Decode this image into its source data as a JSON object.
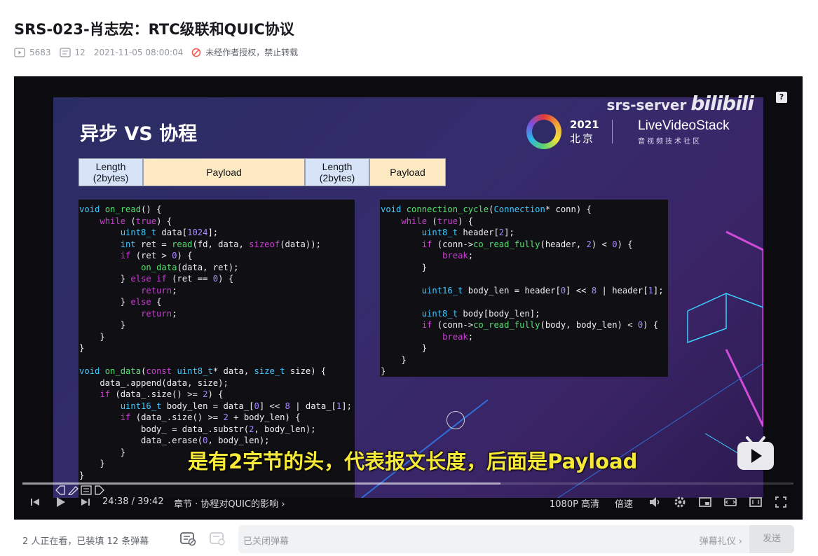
{
  "video": {
    "title": "SRS-023-肖志宏：RTC级联和QUIC协议",
    "views": "5683",
    "danmaku_count": "12",
    "publish_time": "2021-11-05 08:00:04",
    "copyright": "未经作者授权，禁止转载"
  },
  "player": {
    "watermark": "srs-server",
    "watermark_logo": "bilibili",
    "help": "?",
    "subtitle": "是有2字节的头，代表报文长度，后面是Payload",
    "time_current": "24:38",
    "time_total": "39:42",
    "chapter": "章节 · 协程对QUIC的影响",
    "quality": "1080P 高清",
    "speed": "倍速",
    "progress_fraction": 0.62
  },
  "slide": {
    "title": "异步 VS 协程",
    "logo_year": "2021",
    "logo_city": "北京",
    "logo_brand": "LiveVideoStack",
    "logo_sub": "音视频技术社区",
    "packets": [
      "Length\n(2bytes)",
      "Payload",
      "Length\n(2bytes)",
      "Payload"
    ]
  },
  "bottom_bar": {
    "viewers": "2 人正在看，已装填 12 条弹幕",
    "input_placeholder": "已关闭弹幕",
    "etiquette": "弹幕礼仪 ›",
    "send": "发送"
  },
  "colors": {
    "accent": "#00aeec",
    "subtitle": "#f6e93a"
  }
}
